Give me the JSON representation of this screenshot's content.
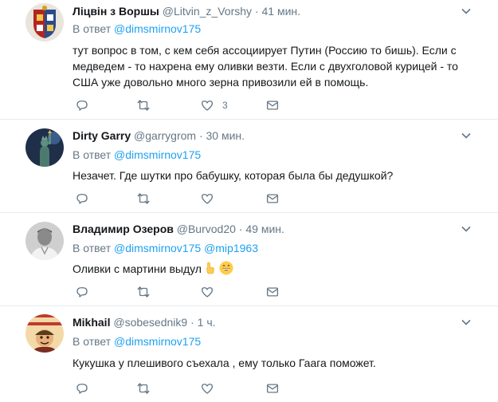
{
  "reply_prefix": "В ответ",
  "tweets": [
    {
      "fullname": "Ліцвін з Воршы",
      "handle": "@Litvin_z_Vorshy",
      "dot": "·",
      "time": "41 мин.",
      "mentions": [
        "@dimsmirnov175"
      ],
      "text": "тут вопрос в том, с кем себя ассоциирует Путин (Россию то бишь). Если с медведем - то нахрена ему оливки везти. Если с двухголовой курицей - то США уже довольно много зерна привозили ей в помощь.",
      "like_count": "3",
      "avatar_icon": "heraldic-coat-of-arms-avatar"
    },
    {
      "fullname": "Dirty Garry",
      "handle": "@garrygrom",
      "dot": "·",
      "time": "30 мин.",
      "mentions": [
        "@dimsmirnov175"
      ],
      "text": "Незачет. Где шутки про бабушку, которая была бы дедушкой?",
      "like_count": "",
      "avatar_icon": "statue-of-liberty-avatar"
    },
    {
      "fullname": "Владимир Озеров",
      "handle": "@Burvod20",
      "dot": "·",
      "time": "49 мин.",
      "mentions": [
        "@dimsmirnov175",
        "@mip1963"
      ],
      "text": "Оливки с мартини выдул",
      "like_count": "",
      "avatar_icon": "man-portrait-avatar"
    },
    {
      "fullname": "Mikhail",
      "handle": "@sobesednik9",
      "dot": "·",
      "time": "1 ч.",
      "mentions": [
        "@dimsmirnov175"
      ],
      "text": "Кукушка у плешивого съехала , ему только Гаага поможет.",
      "like_count": "",
      "avatar_icon": "cartoon-magazine-avatar"
    }
  ],
  "colors": {
    "link": "#1da1f2",
    "muted": "#657786",
    "text": "#14171a",
    "divider": "#e6ecf0"
  }
}
